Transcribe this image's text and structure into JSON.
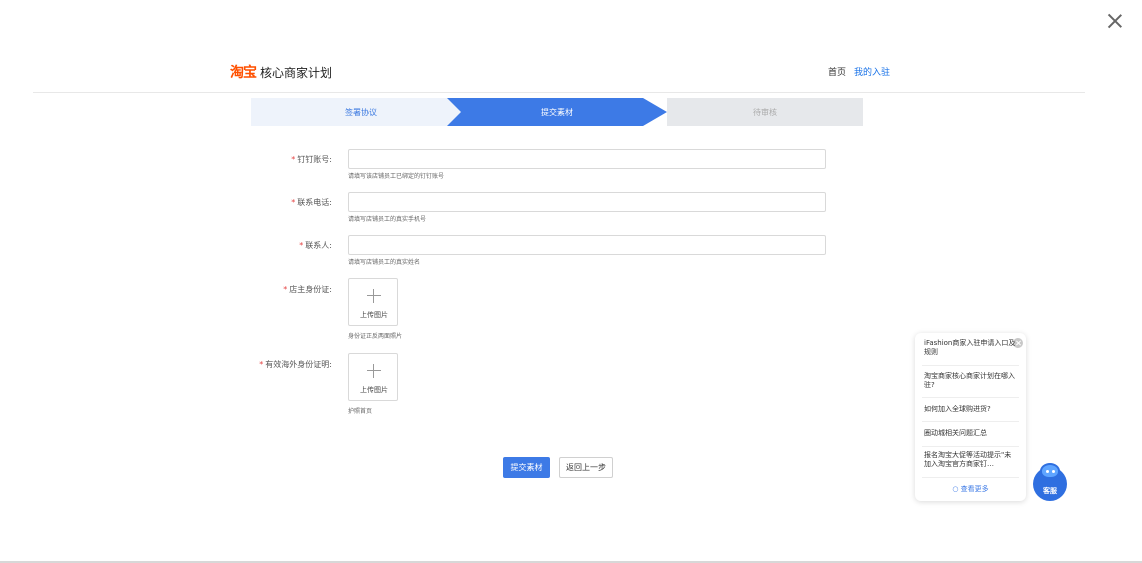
{
  "header": {
    "logo_text": "淘宝",
    "title": "核心商家计划",
    "nav_home": "首页",
    "nav_mine": "我的入驻"
  },
  "steps": [
    {
      "label": "签署协议",
      "state": "done"
    },
    {
      "label": "提交素材",
      "state": "active"
    },
    {
      "label": "待审核",
      "state": "pending"
    }
  ],
  "form": {
    "required_mark": "*",
    "dingtalk": {
      "label": "钉钉账号:",
      "value": "",
      "hint": "请填写该店铺员工已绑定的钉钉账号"
    },
    "phone": {
      "label": "联系电话:",
      "value": "",
      "hint": "请填写店铺员工的真实手机号"
    },
    "contact": {
      "label": "联系人:",
      "value": "",
      "hint": "请填写店铺员工的真实姓名"
    },
    "owner_id": {
      "label": "店主身份证:",
      "upload_text": "上传图片",
      "hint": "身份证正反两面照片"
    },
    "overseas_id": {
      "label": "有效海外身份证明:",
      "upload_text": "上传图片",
      "hint": "护照首页"
    }
  },
  "buttons": {
    "submit": "提交素材",
    "back": "返回上一步"
  },
  "faq": {
    "items": [
      "iFashion商家入驻申请入口及规则",
      "淘宝商家核心商家计划在哪入驻?",
      "如何加入全球购进货?",
      "圈动城相关问题汇总",
      "报名淘宝大促等活动提示\"未加入淘宝官方商家钉…"
    ],
    "more": "查看更多"
  },
  "assistant": {
    "label": "客服"
  },
  "colors": {
    "primary": "#3d7ae6",
    "brand": "#ff5000",
    "required": "#e54545"
  }
}
